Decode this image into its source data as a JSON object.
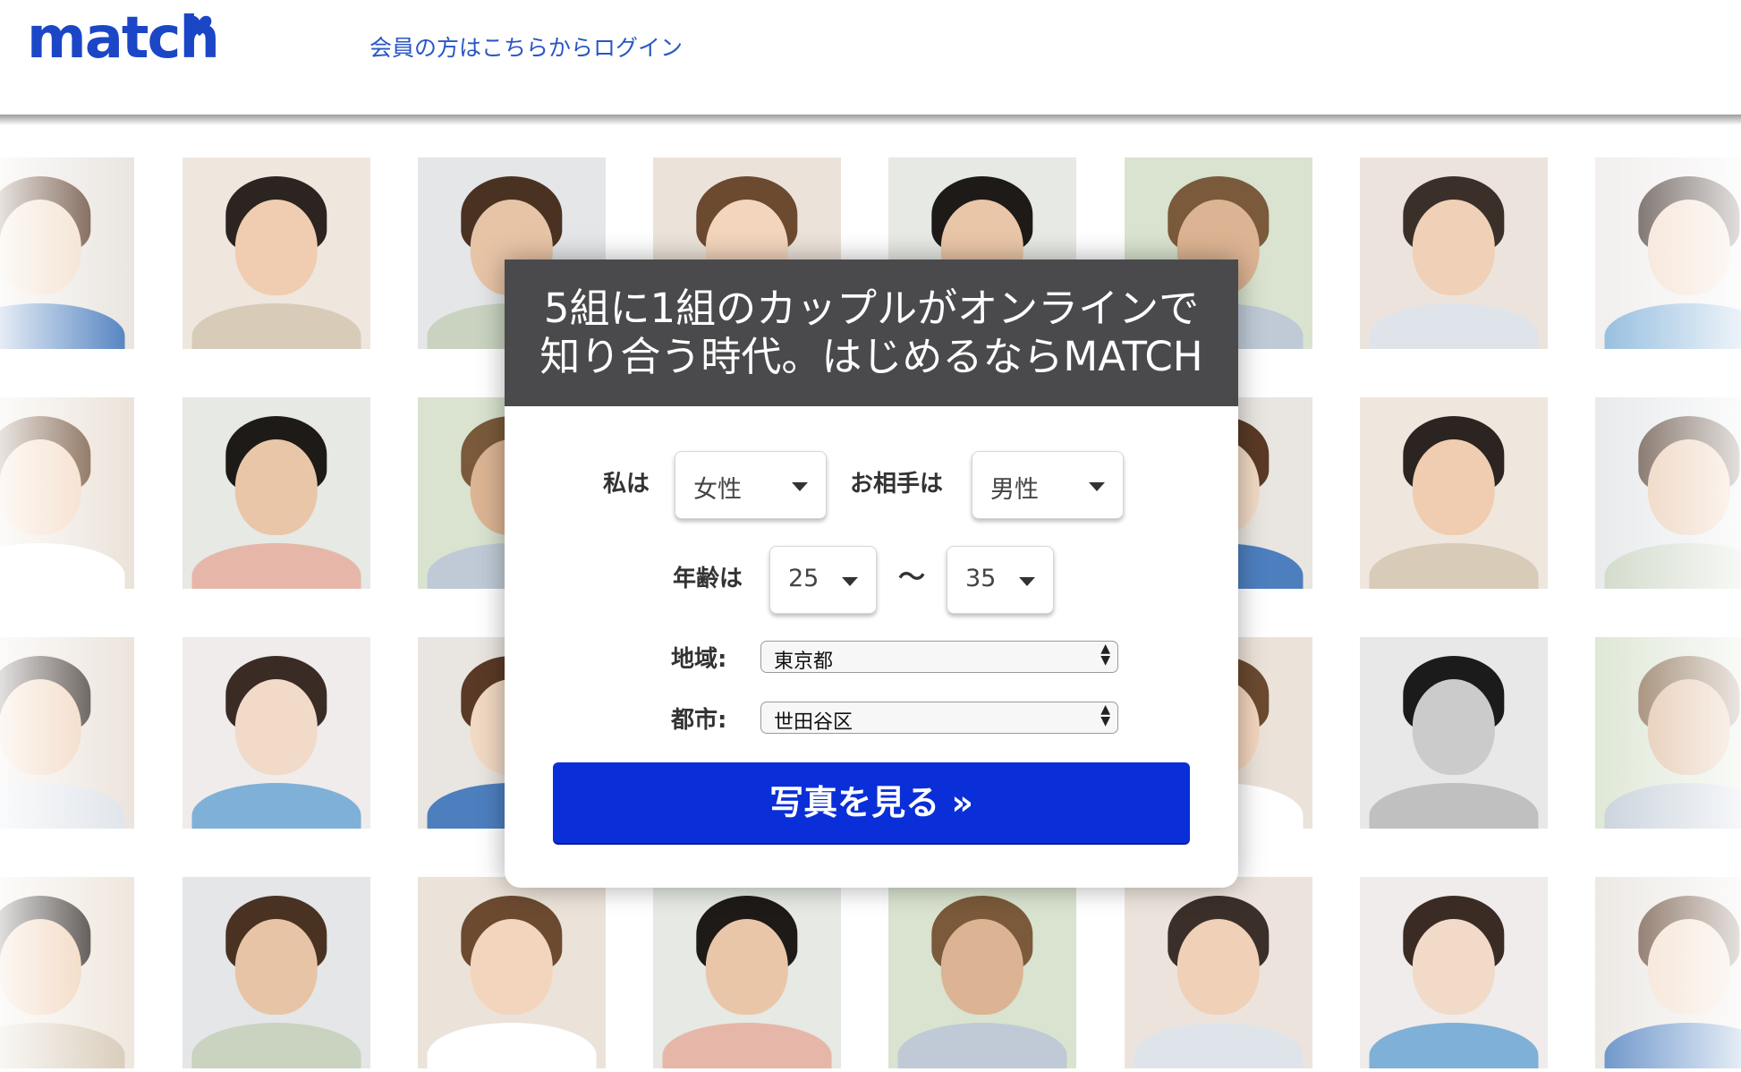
{
  "header": {
    "logo_text": "match",
    "login_link": "会員の方はこちらからログイン",
    "brand_color": "#1b46c6"
  },
  "hero": {
    "headline_line1": "5組に1組のカップルがオンラインで",
    "headline_line2": "知り合う時代。はじめるならMATCH"
  },
  "form": {
    "i_am_label": "私は",
    "i_am_value": "女性",
    "seeking_label": "お相手は",
    "seeking_value": "男性",
    "age_label": "年齢は",
    "age_min": "25",
    "age_separator": "〜",
    "age_max": "35",
    "region_label": "地域:",
    "region_value": "東京都",
    "city_label": "都市:",
    "city_value": "世田谷区",
    "submit_label": "写真を見る »",
    "submit_color": "#0a2ed8"
  },
  "photo_grid": {
    "rows": 4,
    "columns": 8,
    "icon": "person-photo"
  }
}
